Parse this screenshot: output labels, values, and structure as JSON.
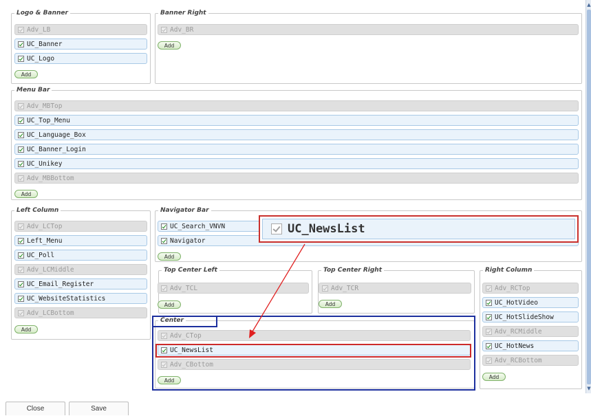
{
  "add_label": "Add",
  "sections": {
    "logo_banner": {
      "title": "Logo & Banner",
      "items": [
        "Adv_LB",
        "UC_Banner",
        "UC_Logo"
      ]
    },
    "banner_right": {
      "title": "Banner Right",
      "items": [
        "Adv_BR"
      ]
    },
    "menu_bar": {
      "title": "Menu Bar",
      "items": [
        "Adv_MBTop",
        "UC_Top_Menu",
        "UC_Language_Box",
        "UC_Banner_Login",
        "UC_Unikey",
        "Adv_MBBottom"
      ]
    },
    "left_column": {
      "title": "Left Column",
      "items": [
        "Adv_LCTop",
        "Left_Menu",
        "UC_Poll",
        "Adv_LCMiddle",
        "UC_Email_Register",
        "UC_WebsiteStatistics",
        "Adv_LCBottom"
      ]
    },
    "navigator_bar": {
      "title": "Navigator Bar",
      "items": [
        "UC_Search_VNVN",
        "Navigator"
      ]
    },
    "top_center_left": {
      "title": "Top Center Left",
      "items": [
        "Adv_TCL"
      ]
    },
    "top_center_right": {
      "title": "Top Center Right",
      "items": [
        "Adv_TCR"
      ]
    },
    "center": {
      "title": "Center",
      "items": [
        "Adv_CTop",
        "UC_NewsList",
        "Adv_CBottom"
      ]
    },
    "right_column": {
      "title": "Right Column",
      "items": [
        "Adv_RCTop",
        "UC_HotVideo",
        "UC_HotSlideShow",
        "Adv_RCMiddle",
        "UC_HotNews",
        "Adv_RCBottom"
      ]
    }
  },
  "zoom_callout": {
    "label": "UC_NewsList"
  },
  "footer": {
    "close_label": "Close",
    "save_label": "Save"
  },
  "colors": {
    "highlight_red": "#cc2a2a",
    "highlight_blue": "#1c2f9e",
    "uc_item_bg": "#eaf3fb",
    "adv_item_bg": "#e0e0e0"
  }
}
